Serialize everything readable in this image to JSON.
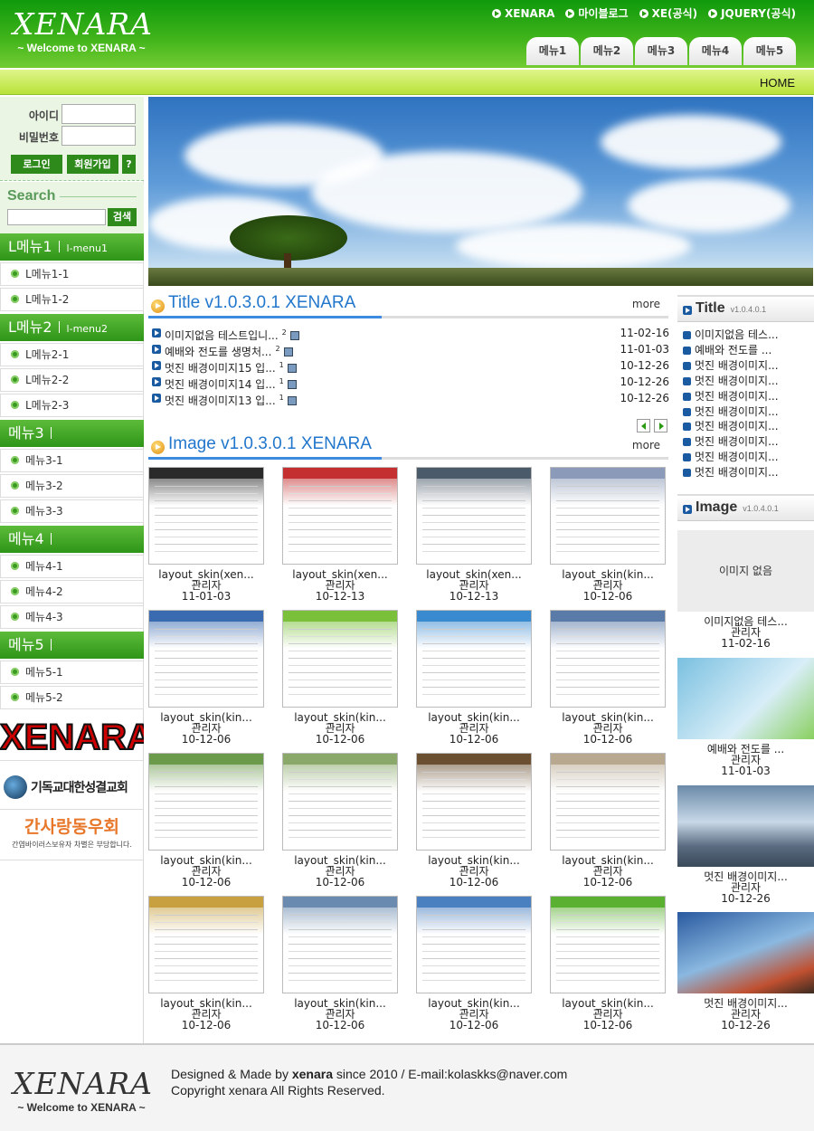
{
  "header": {
    "logo_title": "XENARA",
    "logo_sub": "~ Welcome to XENARA ~",
    "top_links": [
      "XENARA",
      "마이블로그",
      "XE(공식)",
      "JQUERY(공식)"
    ],
    "tabs": [
      "메뉴1",
      "메뉴2",
      "메뉴3",
      "메뉴4",
      "메뉴5"
    ],
    "home": "HOME"
  },
  "login": {
    "id_label": "아이디",
    "pw_label": "비밀번호",
    "login_btn": "로그인",
    "join_btn": "회원가입",
    "help_btn": "?"
  },
  "search": {
    "label": "Search",
    "button": "검색"
  },
  "sidemenu": [
    {
      "title": "L메뉴1",
      "sub": "l-menu1",
      "items": [
        "L메뉴1-1",
        "L메뉴1-2"
      ]
    },
    {
      "title": "L메뉴2",
      "sub": "l-menu2",
      "items": [
        "L메뉴2-1",
        "L메뉴2-2",
        "L메뉴2-3"
      ]
    },
    {
      "title": "메뉴3",
      "sub": "",
      "items": [
        "메뉴3-1",
        "메뉴3-2",
        "메뉴3-3"
      ]
    },
    {
      "title": "메뉴4",
      "sub": "",
      "items": [
        "메뉴4-1",
        "메뉴4-2",
        "메뉴4-3"
      ]
    },
    {
      "title": "메뉴5",
      "sub": "",
      "items": [
        "메뉴5-1",
        "메뉴5-2"
      ]
    }
  ],
  "banners": {
    "b1": "XENARA",
    "b2": "기독교대한성결교회",
    "b3_title": "간사랑동우회",
    "b3_sub": "간염바이러스보유자 차별은 부당합니다."
  },
  "title_section": {
    "title": "Title v1.0.3.0.1 XENARA",
    "more": "more",
    "posts": [
      {
        "title": "이미지없음 테스트입니...",
        "count": "2",
        "date": "11-02-16"
      },
      {
        "title": "예배와 전도를 생명처...",
        "count": "2",
        "date": "11-01-03"
      },
      {
        "title": "멋진 배경이미지15 입...",
        "count": "1",
        "date": "10-12-26"
      },
      {
        "title": "멋진 배경이미지14 입...",
        "count": "1",
        "date": "10-12-26"
      },
      {
        "title": "멋진 배경이미지13 입...",
        "count": "1",
        "date": "10-12-26"
      }
    ]
  },
  "image_section": {
    "title": "Image v1.0.3.0.1 XENARA",
    "more": "more",
    "items": [
      {
        "title": "layout_skin(xen...",
        "author": "관리자",
        "date": "11-01-03",
        "accent": "#2a2a2a"
      },
      {
        "title": "layout_skin(xen...",
        "author": "관리자",
        "date": "10-12-13",
        "accent": "#c43030"
      },
      {
        "title": "layout_skin(xen...",
        "author": "관리자",
        "date": "10-12-13",
        "accent": "#4a5a6a"
      },
      {
        "title": "layout_skin(kin...",
        "author": "관리자",
        "date": "10-12-06",
        "accent": "#8a9ab8"
      },
      {
        "title": "layout_skin(kin...",
        "author": "관리자",
        "date": "10-12-06",
        "accent": "#3a6ab0"
      },
      {
        "title": "layout_skin(kin...",
        "author": "관리자",
        "date": "10-12-06",
        "accent": "#7ac03a"
      },
      {
        "title": "layout_skin(kin...",
        "author": "관리자",
        "date": "10-12-06",
        "accent": "#3a8ad0"
      },
      {
        "title": "layout_skin(kin...",
        "author": "관리자",
        "date": "10-12-06",
        "accent": "#5a7aa8"
      },
      {
        "title": "layout_skin(kin...",
        "author": "관리자",
        "date": "10-12-06",
        "accent": "#6a9a4a"
      },
      {
        "title": "layout_skin(kin...",
        "author": "관리자",
        "date": "10-12-06",
        "accent": "#8aa86a"
      },
      {
        "title": "layout_skin(kin...",
        "author": "관리자",
        "date": "10-12-06",
        "accent": "#6a5030"
      },
      {
        "title": "layout_skin(kin...",
        "author": "관리자",
        "date": "10-12-06",
        "accent": "#b8a890"
      },
      {
        "title": "layout_skin(kin...",
        "author": "관리자",
        "date": "10-12-06",
        "accent": "#c8a040"
      },
      {
        "title": "layout_skin(kin...",
        "author": "관리자",
        "date": "10-12-06",
        "accent": "#6a8ab0"
      },
      {
        "title": "layout_skin(kin...",
        "author": "관리자",
        "date": "10-12-06",
        "accent": "#4a80c0"
      },
      {
        "title": "layout_skin(kin...",
        "author": "관리자",
        "date": "10-12-06",
        "accent": "#5ab030"
      }
    ]
  },
  "right_title": {
    "title": "Title",
    "version": "v1.0.4.0.1",
    "items": [
      "이미지없음 테스...",
      "예배와 전도를 ...",
      "멋진 배경이미지...",
      "멋진 배경이미지...",
      "멋진 배경이미지...",
      "멋진 배경이미지...",
      "멋진 배경이미지...",
      "멋진 배경이미지...",
      "멋진 배경이미지...",
      "멋진 배경이미지..."
    ]
  },
  "right_image": {
    "title": "Image",
    "version": "v1.0.4.0.1",
    "no_image": "이미지 없음",
    "items": [
      {
        "title": "이미지없음 테스...",
        "author": "관리자",
        "date": "11-02-16"
      },
      {
        "title": "예배와 전도를 ...",
        "author": "관리자",
        "date": "11-01-03"
      },
      {
        "title": "멋진 배경이미지...",
        "author": "관리자",
        "date": "10-12-26"
      },
      {
        "title": "멋진 배경이미지...",
        "author": "관리자",
        "date": "10-12-26"
      }
    ]
  },
  "footer": {
    "logo_title": "XENARA",
    "logo_sub": "~ Welcome to XENARA ~",
    "line1_prefix": "Designed & Made by ",
    "line1_name": "xenara",
    "line1_suffix": " since 2010 / E-mail:kolaskks@naver.com",
    "line2": "Copyright xenara All Rights Reserved."
  },
  "colors": {
    "brand_green": "#2e9518",
    "lime": "#b9e23a",
    "link_blue": "#2277cc"
  }
}
